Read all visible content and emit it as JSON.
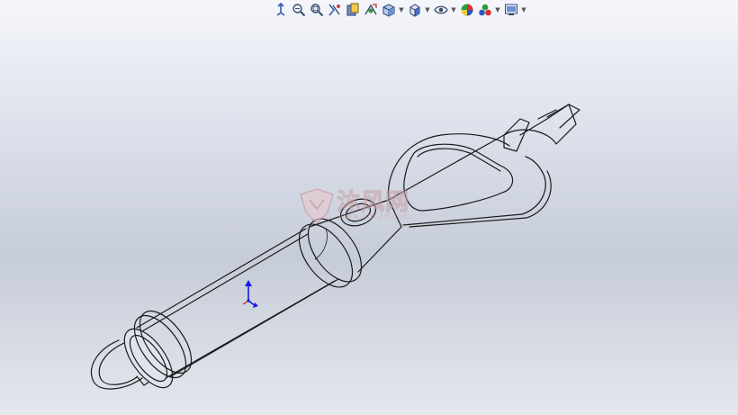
{
  "toolbar": {
    "items": [
      {
        "name": "view-orientation-icon",
        "dropdown": false
      },
      {
        "name": "zoom-to-fit-icon",
        "dropdown": false
      },
      {
        "name": "zoom-to-area-icon",
        "dropdown": false
      },
      {
        "name": "previous-view-icon",
        "dropdown": false
      },
      {
        "name": "section-view-icon",
        "dropdown": false
      },
      {
        "name": "dynamic-annotation-icon",
        "dropdown": false
      },
      {
        "name": "view-orientation-cube-icon",
        "dropdown": true
      },
      {
        "name": "display-style-icon",
        "dropdown": true
      },
      {
        "name": "hide-show-items-icon",
        "dropdown": true
      },
      {
        "name": "edit-appearance-icon",
        "dropdown": false
      },
      {
        "name": "apply-scene-icon",
        "dropdown": true
      },
      {
        "name": "view-settings-icon",
        "dropdown": true
      }
    ]
  },
  "watermark": {
    "text_cn": "沐风网",
    "text_en": "www.mfcad.com"
  },
  "colors": {
    "model_edge": "#1a1a1a",
    "model_face": "#d3d8e2",
    "triad_blue": "#1818e6",
    "triad_red": "#d21c1c"
  }
}
